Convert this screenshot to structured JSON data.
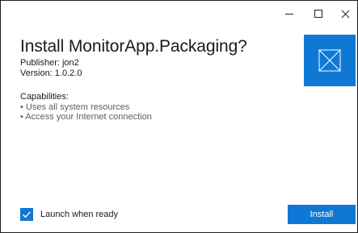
{
  "window": {
    "controls": {
      "minimize_icon": "minimize-icon",
      "maximize_icon": "maximize-icon",
      "close_icon": "close-icon"
    }
  },
  "installer": {
    "title": "Install MonitorApp.Packaging?",
    "publisher": "Publisher: jon2",
    "version": "Version: 1.0.2.0",
    "capabilities_heading": "Capabilities:",
    "capabilities": [
      "Uses all system resources",
      "Access your Internet connection"
    ],
    "app_icon": "app-placeholder-icon"
  },
  "footer": {
    "launch_label": "Launch when ready",
    "launch_checked": true,
    "install_label": "Install"
  },
  "colors": {
    "accent": "#0f78d4",
    "text": "#1a1a1a",
    "secondary_text": "#5e5e5e",
    "background": "#ffffff"
  }
}
